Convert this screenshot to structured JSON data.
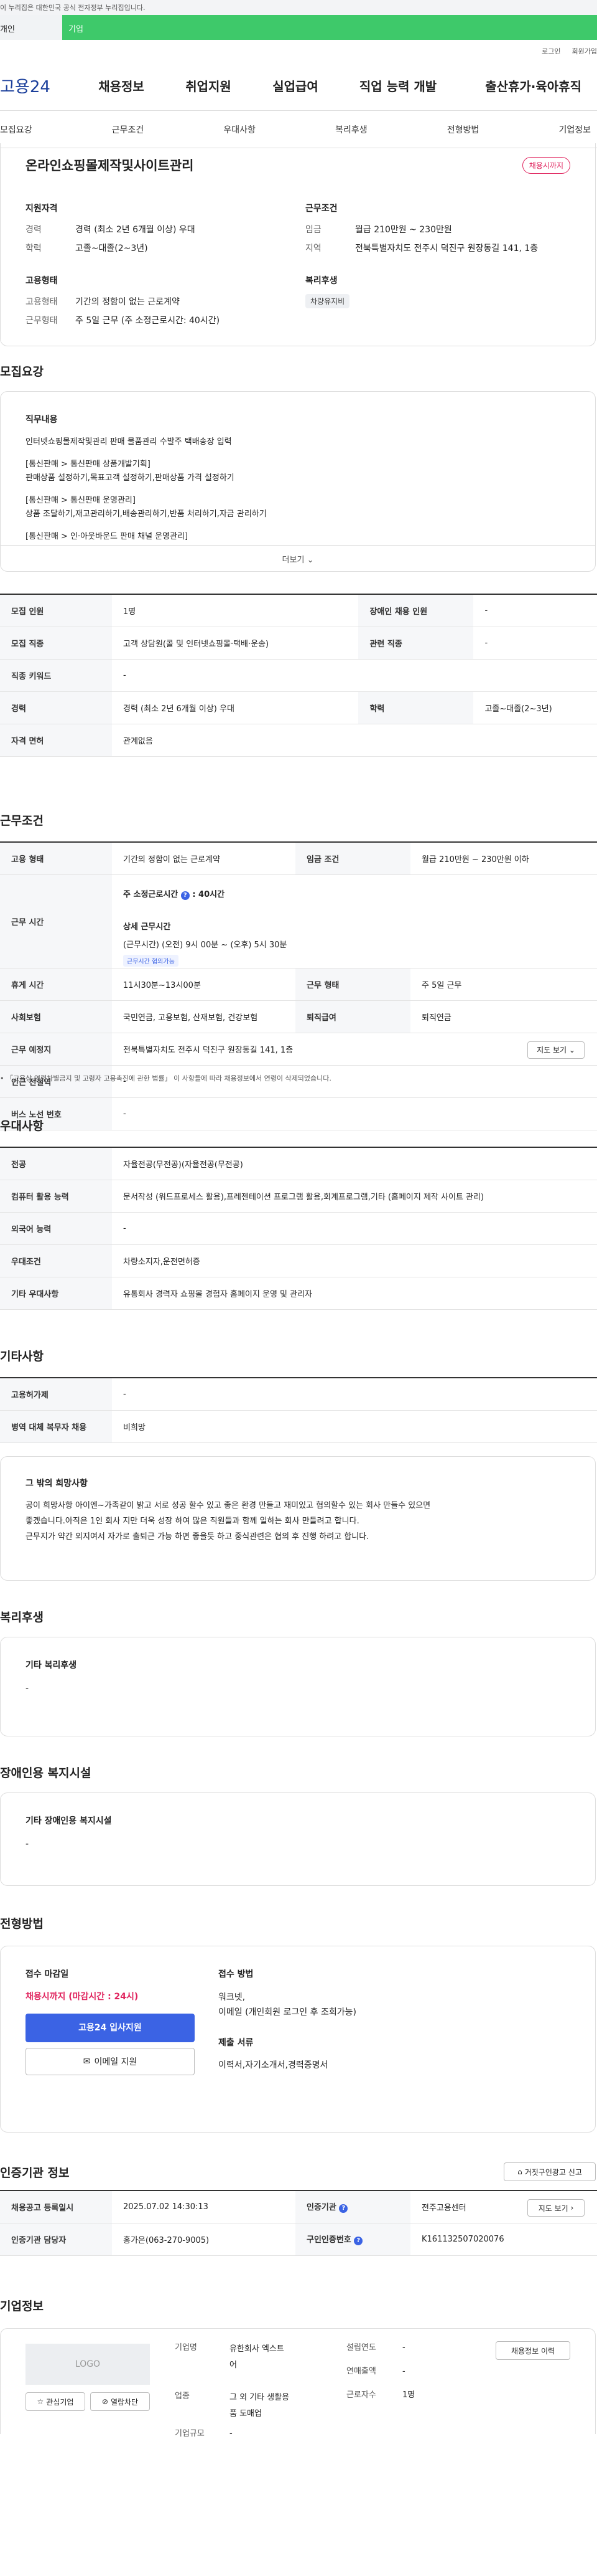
{
  "gov_banner": "이 누리집은 대한민국 공식 전자정부 누리집입니다.",
  "top_tabs": {
    "a": "개인",
    "b": "기업"
  },
  "util": {
    "login": "로그인",
    "join": "회원가입"
  },
  "gnb": {
    "logo": "고용24",
    "menus": [
      "채용정보",
      "취업지원",
      "실업급여",
      "직업 능력 개발",
      "출산휴가·육아휴직"
    ]
  },
  "anchors": [
    "모집요강",
    "근무조건",
    "우대사항",
    "복리후생",
    "전형방법",
    "기업정보"
  ],
  "summary": {
    "job_title": "온라인쇼핑몰제작및사이트관리",
    "badge": "채용시까지",
    "qual_title": "지원자격",
    "career_k": "경력",
    "career_v": "경력 (최소 2년 6개월 이상) 우대",
    "edu_k": "학력",
    "edu_v": "고졸~대졸(2~3년)",
    "cond_title": "근무조건",
    "wage_k": "임금",
    "wage_v": "월급 210만원 ~ 230만원",
    "region_k": "지역",
    "region_v": "전북특별자치도 전주시 덕진구 원장동길 141, 1층",
    "emp_title": "고용형태",
    "emptype_k": "고용형태",
    "emptype_v": "기간의 정함이 없는 근로계약",
    "worktype_k": "근무형태",
    "worktype_v": "주 5일 근무 (주 소정근로시간: 40시간)",
    "welfare_title": "복리후생",
    "welfare_chip": "차량유지비"
  },
  "recruit": {
    "title": "모집요강",
    "job_content_title": "직무내용",
    "lines": [
      "인터넷쇼핑몰제작및관리 판매 물품관리 수발주 택배송장 입력",
      "",
      "[통신판매 > 통신판매 상품개발기획]",
      "판매상품  설정하기,목표고객 설정하기,판매상품 가격 설정하기",
      "",
      "[통신판매 > 통신판매 운영관리]",
      "상품 조달하기,재고관리하기,배송관리하기,반품 처리하기,자금 관리하기",
      "",
      "[통신판매 > 인·아웃바운드 판매 채널 운영관리]"
    ],
    "more": "더보기",
    "rows": [
      {
        "k1": "모집 인원",
        "v1": "1명",
        "k2": "장애인 채용 인원",
        "v2": "-"
      },
      {
        "k1": "모집 직종",
        "v1": "고객 상담원(콜 및 인터넷쇼핑몰·택배·운송)",
        "k2": "관련 직종",
        "v2": "-"
      },
      {
        "k1": "직종 키워드",
        "v1": "-"
      },
      {
        "k1": "경력",
        "v1": "경력 (최소 2년 6개월 이상) 우대",
        "k2": "학력",
        "v2": "고졸~대졸(2~3년)"
      },
      {
        "k1": "자격 면허",
        "v1": "관계없음"
      }
    ]
  },
  "conditions": {
    "title": "근무조건",
    "emp_k": "고용 형태",
    "emp_v": "기간의 정함이 없는 근로계약",
    "wage_k": "임금 조건",
    "wage_v": "월급 210만원 ~ 230만원 이하",
    "hours_k": "근무 시간",
    "weekly": "주 소정근로시간",
    "weekly_v": ": 40시간",
    "detail_title": "상세 근무시간",
    "detail_v": "(근무시간) (오전) 9시 00분 ~ (오후) 5시 30분",
    "detail_chip": "근무시간 협의가능",
    "break_k": "휴게 시간",
    "break_v": "11시30분~13시00분",
    "form_k": "근무 형태",
    "form_v": "주 5일 근무",
    "ins_k": "사회보험",
    "ins_v": "국민연금, 고용보험, 산재보험, 건강보험",
    "retire_k": "퇴직급여",
    "retire_v": "퇴직연금",
    "place_k": "근무 예정지",
    "place_v": "전북특별자치도 전주시 덕진구 원장동길 141, 1층",
    "map_btn": "지도 보기",
    "subway_k": "인근 전철역",
    "subway_v": "-",
    "bus_k": "버스 노선 번호",
    "bus_v": "-",
    "note": "「고용상 연령차별금지 및 고령자 고용촉진에 관한 법률」 이 사항들에 따라 채용정보에서 연령이 삭제되었습니다."
  },
  "prefs": {
    "title": "우대사항",
    "rows": [
      {
        "k": "전공",
        "v": "자율전공(무전공)(자율전공(무전공)"
      },
      {
        "k": "컴퓨터 활용 능력",
        "v": "문서작성 (워드프로세스 활용),프레젠테이션 프로그램 활용,회계프로그램,기타 (홈페이지 제작 사이트 관리)"
      },
      {
        "k": "외국어 능력",
        "v": "-"
      },
      {
        "k": "우대조건",
        "v": "차량소지자,운전면허증"
      },
      {
        "k": "기타 우대사항",
        "v": "유통회사 경력자 쇼핑몰 경험자 홈페이지 운영 및 관리자"
      }
    ]
  },
  "etc": {
    "title": "기타사항",
    "rows": [
      {
        "k": "고용허가제",
        "v": "-"
      },
      {
        "k": "병역 대체 복무자 채용",
        "v": "비희망"
      }
    ],
    "memo_title": "그 밖의 희망사항",
    "memo_lines": [
      "공이 희망사항 아이엔~가족같이 밝고 서로 성공 할수 있고 좋은 환경 만들고 재미있고 협의할수 있는 회사 만들수 있으면",
      "좋겠습니다.아직은 1인 회사 지만 더욱 성장 하여 많은 직원들과 함께 일하는 회사 만들려고 합니다.",
      "근무지가 약간 외지여서 자가로 출퇴근 가능 하면 좋을듯 하고 중식관련은 협의 후 진행 하려고 합니다."
    ]
  },
  "welfare": {
    "title": "복리후생",
    "sub": "기타 복리후생",
    "value": "-"
  },
  "disability": {
    "title": "장애인용 복지시설",
    "sub": "기타 장애인용 복지시설",
    "value": "-"
  },
  "selection": {
    "title": "전형방법",
    "deadline_title": "접수 마감일",
    "deadline_v": "채용시까지 (마감시간 : 24시)",
    "apply_btn": "고용24 입사지원",
    "email_btn": "이메일 지원",
    "method_title": "접수 방법",
    "method_v1": "워크넷,",
    "method_v2": "이메일 (개인회원 로그인 후 조회가능)",
    "docs_title": "제출 서류",
    "docs_v": "이력서,자기소개서,경력증명서"
  },
  "agency": {
    "title": "인증기관 정보",
    "report_btn": "거짓구인광고 신고",
    "rows": [
      {
        "k1": "채용공고 등록일시",
        "v1": "2025.07.02 14:30:13",
        "k2": "인증기관",
        "v2": "전주고용센터",
        "btn": "지도 보기"
      },
      {
        "k1": "인증기관 담당자",
        "v1": "홍가은(063-270-9005)",
        "k2": "구인인증번호",
        "v2": "K161132507020076"
      }
    ]
  },
  "company": {
    "title": "기업정보",
    "logo": "LOGO",
    "fav_btn": "관심기업",
    "block_btn": "열람차단",
    "list_btn": "채용정보 이력",
    "name_k": "기업명",
    "name_v1": "유한회사 엑스트",
    "name_v2": "어",
    "year_k": "설립연도",
    "year_v": "-",
    "sales_k": "연매출액",
    "sales_v": "-",
    "biz_k": "업종",
    "biz_v1": "그 외 기타 생활용",
    "biz_v2": "품 도매업",
    "emp_k": "근로자수",
    "emp_v": "1명",
    "size_k": "기업규모",
    "size_v": "-"
  },
  "colors": {
    "brand_blue": "#3b63e4",
    "accent_red": "#e0245e",
    "tab_green": "#3ec96a"
  }
}
